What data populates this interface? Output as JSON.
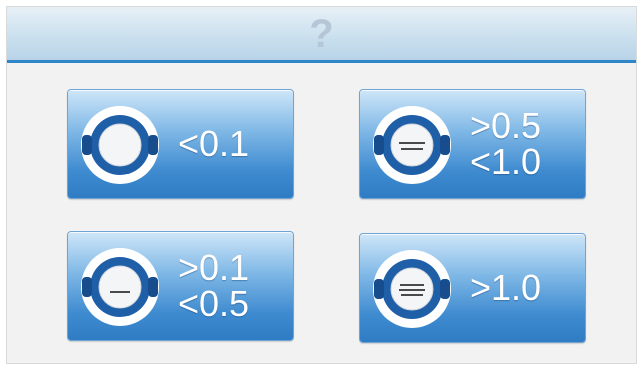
{
  "header": {
    "help_symbol": "?"
  },
  "tiles": [
    {
      "lines": [
        "<0.1"
      ],
      "icon": "gauge-icon-empty",
      "bars": 0
    },
    {
      "lines": [
        ">0.5",
        "<1.0"
      ],
      "icon": "gauge-icon-two-bars",
      "bars": 2
    },
    {
      "lines": [
        ">0.1",
        "<0.5"
      ],
      "icon": "gauge-icon-one-bar",
      "bars": 1
    },
    {
      "lines": [
        ">1.0"
      ],
      "icon": "gauge-icon-three-bars",
      "bars": 3
    }
  ],
  "colors": {
    "accent": "#2f86c9",
    "tile_top": "#cfe6f8",
    "tile_bottom": "#2f7cc4",
    "text": "#ffffff"
  }
}
